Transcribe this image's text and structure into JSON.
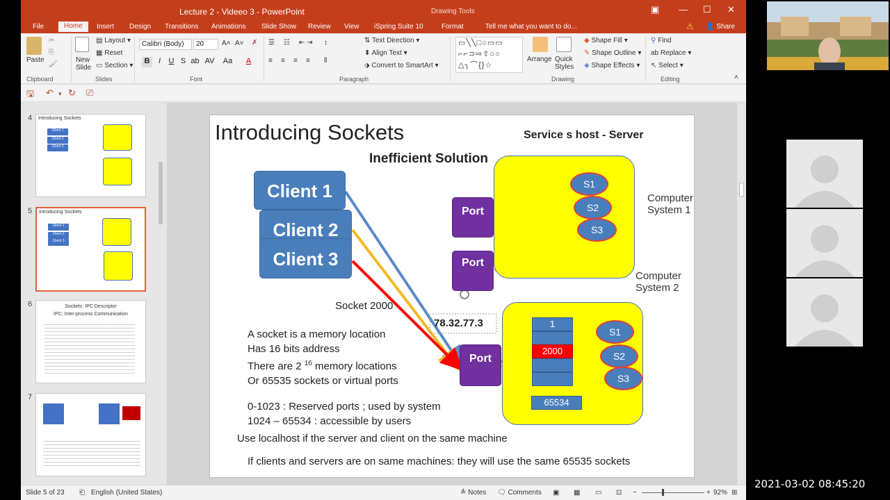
{
  "window": {
    "title": "Lecture 2 - Videeo 3 - PowerPoint",
    "context_tab": "Drawing Tools"
  },
  "tabs": [
    "File",
    "Home",
    "Insert",
    "Design",
    "Transitions",
    "Animations",
    "Slide Show",
    "Review",
    "View",
    "iSpring Suite 10",
    "Format"
  ],
  "tell_me": "Tell me what you want to do...",
  "share": "Share",
  "ribbon": {
    "paste": "Paste",
    "new_slide": "New Slide",
    "layout": "Layout",
    "reset": "Reset",
    "section": "Section",
    "font_name": "Calibri (Body)",
    "font_size": "20",
    "text_direction": "Text Direction",
    "align_text": "Align Text",
    "convert_smartart": "Convert to SmartArt",
    "arrange": "Arrange",
    "quick_styles": "Quick Styles",
    "shape_fill": "Shape Fill",
    "shape_outline": "Shape Outline",
    "shape_effects": "Shape Effects",
    "find": "Find",
    "replace": "Replace",
    "select": "Select",
    "groups": {
      "clipboard": "Clipboard",
      "slides": "Slides",
      "font": "Font",
      "paragraph": "Paragraph",
      "drawing": "Drawing",
      "editing": "Editing"
    }
  },
  "thumbnails": {
    "numbers": [
      "4",
      "5",
      "6",
      "7"
    ],
    "t4_title": "Introducing Sockets",
    "t5_title": "Introducing Sockets",
    "t6_line1": "Sockets: IPC Descriptor",
    "t6_line2": "IPC: Inter-process Communication",
    "mini_clients": [
      "Client 1",
      "Client 2",
      "Client 3"
    ]
  },
  "slide": {
    "title": "Introducing Sockets",
    "server_heading": "Service s host - Server",
    "subtitle": "Inefficient Solution",
    "clients": [
      "Client 1",
      "Client 2",
      "Client 3"
    ],
    "port_label": "Port",
    "port_partial": "Port",
    "services": [
      "S1",
      "S2",
      "S3"
    ],
    "computer_system_1": [
      "Computer",
      "System 1"
    ],
    "computer_system_2": [
      "Computer",
      "System 2"
    ],
    "socket_label": "Socket 2000",
    "ip_address": "78.32.77.3",
    "memory_cells": [
      "1",
      "2000",
      "65534"
    ],
    "body_lines": [
      "A socket is a memory location",
      "Has 16 bits address",
      "There are 2",
      "memory locations",
      "Or 65535 sockets or virtual ports"
    ],
    "exponent": "16",
    "port_ranges": [
      "0-1023 : Reserved ports ; used by system",
      "1024 – 65534 : accessible by users"
    ],
    "localhost_note": "Use localhost if the server and client on the same machine",
    "same_machine_note": "If clients and servers are on same machines: they will use the same 65535 sockets"
  },
  "statusbar": {
    "slide_of": "Slide 5 of 23",
    "language": "English (United States)",
    "notes": "Notes",
    "comments": "Comments",
    "zoom": "92%"
  },
  "timestamp": "2021-03-02  08:45:20",
  "colors": {
    "ppt_accent": "#c43e1c",
    "client_blue": "#4a7ebb",
    "port_purple": "#7030a0",
    "system_yellow": "#ffff00",
    "arrow_red": "#ff0000",
    "arrow_orange": "#f5b823",
    "arrow_cyan": "#1fb0d8"
  }
}
